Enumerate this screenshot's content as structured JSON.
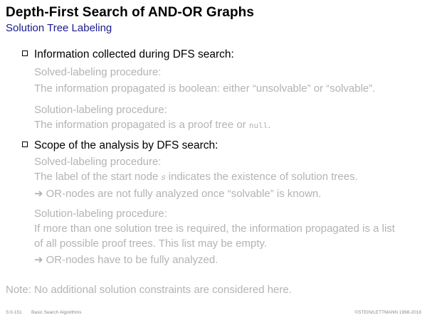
{
  "header": {
    "title": "Depth-First Search of AND-OR Graphs",
    "subtitle": "Solution Tree Labeling"
  },
  "section1": {
    "heading": "Information collected during DFS search:",
    "solved_label": "Solved-labeling procedure:",
    "solved_text": "The information propagated is boolean: either “unsolvable” or “solvable”.",
    "solution_label": "Solution-labeling procedure:",
    "solution_text_before": "The information propagated is a proof tree or ",
    "solution_text_code": "null",
    "solution_text_after": "."
  },
  "section2": {
    "heading": "Scope of the analysis by DFS search:",
    "solved_label": "Solved-labeling procedure:",
    "solved_text_before": "The label of the start node ",
    "solved_text_var": "s",
    "solved_text_after": " indicates the existence of solution trees.",
    "solved_conclusion": "OR-nodes are not fully analyzed once “solvable” is known.",
    "solution_label": "Solution-labeling procedure:",
    "solution_text_line1": "If more than one solution tree is required, the information propagated is a list",
    "solution_text_line2": "of all possible proof trees. This list may be empty.",
    "solution_conclusion": "OR-nodes have to be fully analyzed."
  },
  "note": "Note: No additional solution constraints are considered here.",
  "footer": {
    "slide_number": "S:II-151",
    "course": "Basic Search Algorithms",
    "copyright": "©STEIN/LETTMANN 1998-2018"
  },
  "colors": {
    "subtitle": "#1a1a8c",
    "gray_text": "#b3b3b3"
  },
  "icons": {
    "bullet": "square-bullet-icon",
    "implication": "arrow-right-icon"
  }
}
